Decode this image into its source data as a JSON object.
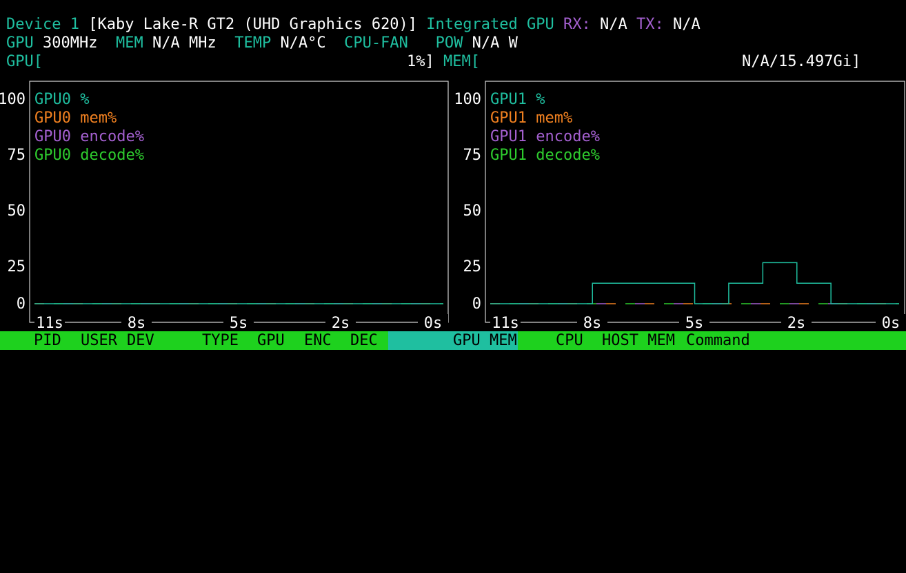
{
  "device": {
    "label": "Device 1",
    "name": "[Kaby Lake-R GT2 (UHD Graphics 620)]",
    "type": "Integrated GPU",
    "rx_label": "RX:",
    "rx_value": "N/A",
    "tx_label": "TX:",
    "tx_value": "N/A"
  },
  "stats": {
    "gpu_label": "GPU",
    "gpu_value": "300MHz",
    "mem_label": "MEM",
    "mem_value": "N/A MHz",
    "temp_label": "TEMP",
    "temp_value": "N/A°C",
    "fan_label": "CPU-FAN",
    "pow_label": "POW",
    "pow_value": "N/A W"
  },
  "bars": {
    "gpu_label": "GPU[",
    "gpu_value": "1%]",
    "gpu_percent": 1,
    "mem_label": "MEM[",
    "mem_value": "N/A/15.497Gi]"
  },
  "chart_data": [
    {
      "type": "line",
      "y_ticks": [
        "100",
        "75",
        "50",
        "25",
        "0"
      ],
      "x_ticks": [
        "11s",
        "8s",
        "5s",
        "2s",
        "0s"
      ],
      "ylim": [
        0,
        100
      ],
      "series": [
        {
          "name": "GPU0 %",
          "color": "#1fbfa0",
          "values": [
            0,
            0,
            0,
            0,
            0,
            0,
            0,
            0,
            0,
            0,
            0,
            0
          ]
        },
        {
          "name": "GPU0 mem%",
          "color": "#f08020",
          "values": [
            0,
            0,
            0,
            0,
            0,
            0,
            0,
            0,
            0,
            0,
            0,
            0
          ]
        },
        {
          "name": "GPU0 encode%",
          "color": "#a460d0",
          "values": [
            0,
            0,
            0,
            0,
            0,
            0,
            0,
            0,
            0,
            0,
            0,
            0
          ]
        },
        {
          "name": "GPU0 decode%",
          "color": "#2ecc2e",
          "values": [
            0,
            0,
            0,
            0,
            0,
            0,
            0,
            0,
            0,
            0,
            0,
            0
          ]
        }
      ]
    },
    {
      "type": "line",
      "y_ticks": [
        "100",
        "75",
        "50",
        "25",
        "0"
      ],
      "x_ticks": [
        "11s",
        "8s",
        "5s",
        "2s",
        "0s"
      ],
      "ylim": [
        0,
        100
      ],
      "series": [
        {
          "name": "GPU1 %",
          "color": "#1fbfa0",
          "values": [
            0,
            0,
            0,
            10,
            10,
            10,
            0,
            10,
            20,
            10,
            0,
            0
          ]
        },
        {
          "name": "GPU1 mem%",
          "color": "#f08020",
          "values": [
            0,
            0,
            0,
            0,
            0,
            0,
            0,
            0,
            0,
            0,
            0,
            0
          ]
        },
        {
          "name": "GPU1 encode%",
          "color": "#a460d0",
          "values": [
            0,
            0,
            0,
            0,
            0,
            0,
            0,
            0,
            0,
            0,
            0,
            0
          ]
        },
        {
          "name": "GPU1 decode%",
          "color": "#2ecc2e",
          "values": [
            0,
            0,
            0,
            0,
            0,
            0,
            0,
            0,
            0,
            0,
            0,
            0
          ]
        }
      ]
    }
  ],
  "table_header": {
    "pid": "PID",
    "user": "USER",
    "dev": "DEV",
    "type": "TYPE",
    "gpu": "GPU",
    "enc": "ENC",
    "dec": "DEC",
    "gpu_mem": "GPU MEM",
    "cpu": "CPU",
    "host_mem": "HOST MEM",
    "command": "Command"
  }
}
